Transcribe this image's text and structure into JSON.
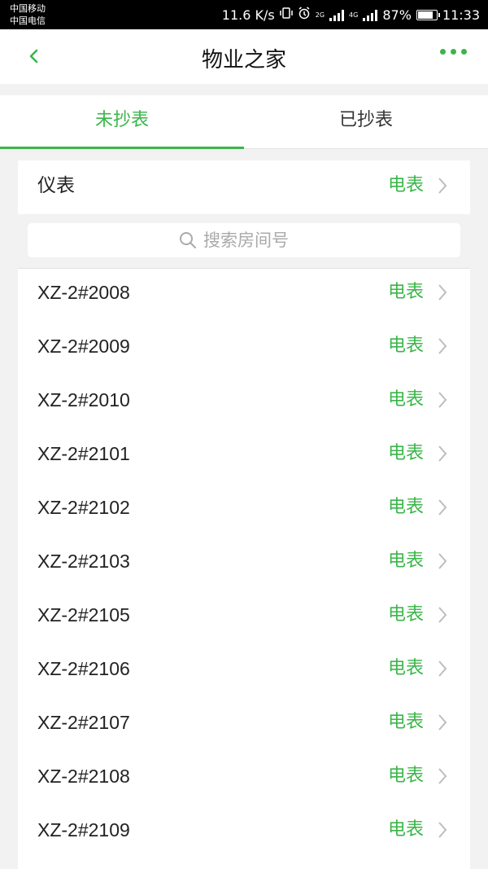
{
  "status_bar": {
    "carrier_1": "中国移动",
    "carrier_2": "中国电信",
    "net_speed": "11.6 K/s",
    "net_tag_1": "2G",
    "net_tag_2": "4G",
    "battery_percent": "87%",
    "battery_level": 0.87,
    "time": "11:33"
  },
  "header": {
    "title": "物业之家",
    "back_icon": "chevron-left-icon",
    "more_icon": "more-dots-icon",
    "accent_color": "#3bb54a"
  },
  "tabs": [
    {
      "label": "未抄表",
      "active": true
    },
    {
      "label": "已抄表",
      "active": false
    }
  ],
  "meter_filter": {
    "label": "仪表",
    "value": "电表"
  },
  "search": {
    "placeholder": "搜索房间号"
  },
  "rooms": [
    {
      "room": "XZ-2#2008",
      "meter": "电表"
    },
    {
      "room": "XZ-2#2009",
      "meter": "电表"
    },
    {
      "room": "XZ-2#2010",
      "meter": "电表"
    },
    {
      "room": "XZ-2#2101",
      "meter": "电表"
    },
    {
      "room": "XZ-2#2102",
      "meter": "电表"
    },
    {
      "room": "XZ-2#2103",
      "meter": "电表"
    },
    {
      "room": "XZ-2#2105",
      "meter": "电表"
    },
    {
      "room": "XZ-2#2106",
      "meter": "电表"
    },
    {
      "room": "XZ-2#2107",
      "meter": "电表"
    },
    {
      "room": "XZ-2#2108",
      "meter": "电表"
    },
    {
      "room": "XZ-2#2109",
      "meter": "电表"
    }
  ]
}
